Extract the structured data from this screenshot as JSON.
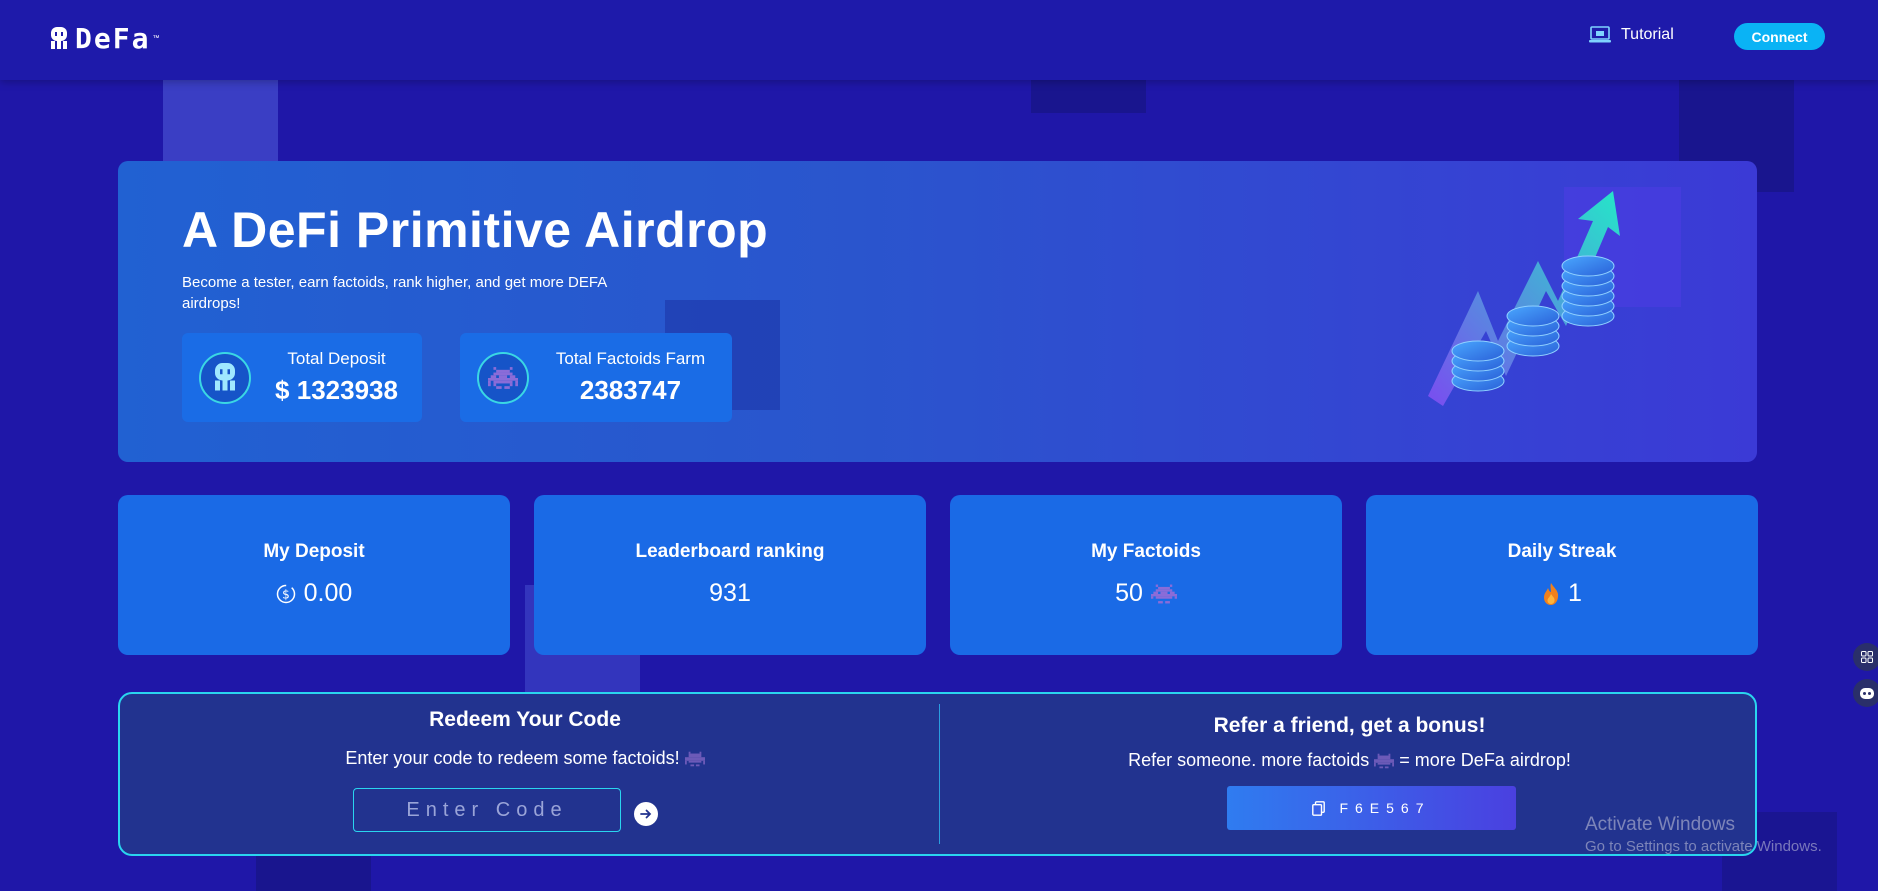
{
  "header": {
    "logo_text": "DeFa",
    "logo_tm": "™",
    "tutorial_label": "Tutorial",
    "connect_label": "Connect"
  },
  "hero": {
    "title": "A DeFi Primitive Airdrop",
    "subtitle": "Become a tester, earn factoids, rank higher, and get more DEFA airdrops!",
    "total_deposit_label": "Total Deposit",
    "total_deposit_value": "$ 1323938",
    "total_farm_label": "Total Factoids Farm",
    "total_farm_value": "2383747"
  },
  "metrics": [
    {
      "title": "My Deposit",
      "value": "0.00",
      "icon": "dollar-coin-icon"
    },
    {
      "title": "Leaderboard ranking",
      "value": "931"
    },
    {
      "title": "My Factoids",
      "value": "50",
      "icon": "factoid-alien-icon"
    },
    {
      "title": "Daily Streak",
      "value": "1",
      "icon": "fire-icon"
    }
  ],
  "redeem": {
    "title": "Redeem Your Code",
    "subtitle": "Enter your code to redeem some factoids!",
    "placeholder": "Enter Code"
  },
  "refer": {
    "title": "Refer a friend, get a bonus!",
    "subtitle_part1": "Refer someone. more factoids",
    "subtitle_part2": "= more DeFa airdrop!",
    "code": "F6E567"
  },
  "watermark": {
    "title": "Activate Windows",
    "subtitle": "Go to Settings to activate Windows."
  },
  "colors": {
    "background": "#1f17a8",
    "accent_cyan": "#2ad5ef",
    "card_blue": "#1a6ae6",
    "connect": "#0ab3f5"
  }
}
